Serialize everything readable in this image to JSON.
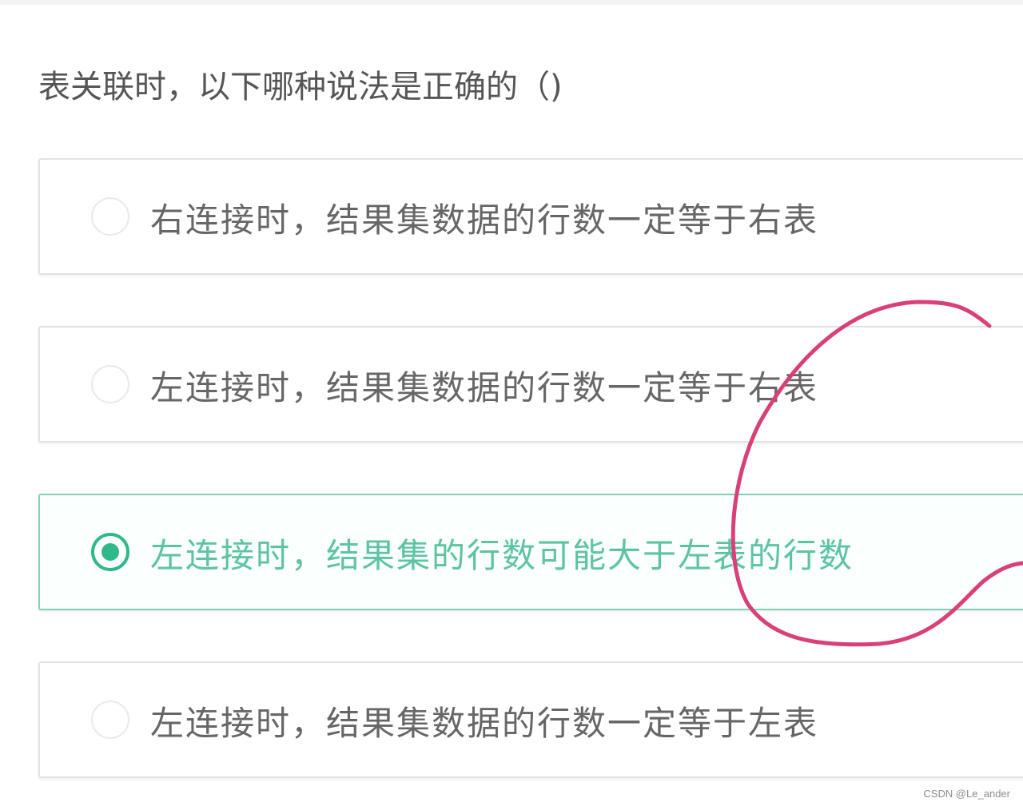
{
  "question": {
    "text": "表关联时，以下哪种说法是正确的（)"
  },
  "options": [
    {
      "label": "右连接时，结果集数据的行数一定等于右表",
      "selected": false
    },
    {
      "label": "左连接时，结果集数据的行数一定等于右表",
      "selected": false
    },
    {
      "label": "左连接时，结果集的行数可能大于左表的行数",
      "selected": true
    },
    {
      "label": "左连接时，结果集数据的行数一定等于左表",
      "selected": false
    }
  ],
  "colors": {
    "accent": "#2fb889",
    "selected_text": "#5cc3a3",
    "annotation_ink": "#d9407a"
  },
  "watermark": "CSDN @Le_ander"
}
